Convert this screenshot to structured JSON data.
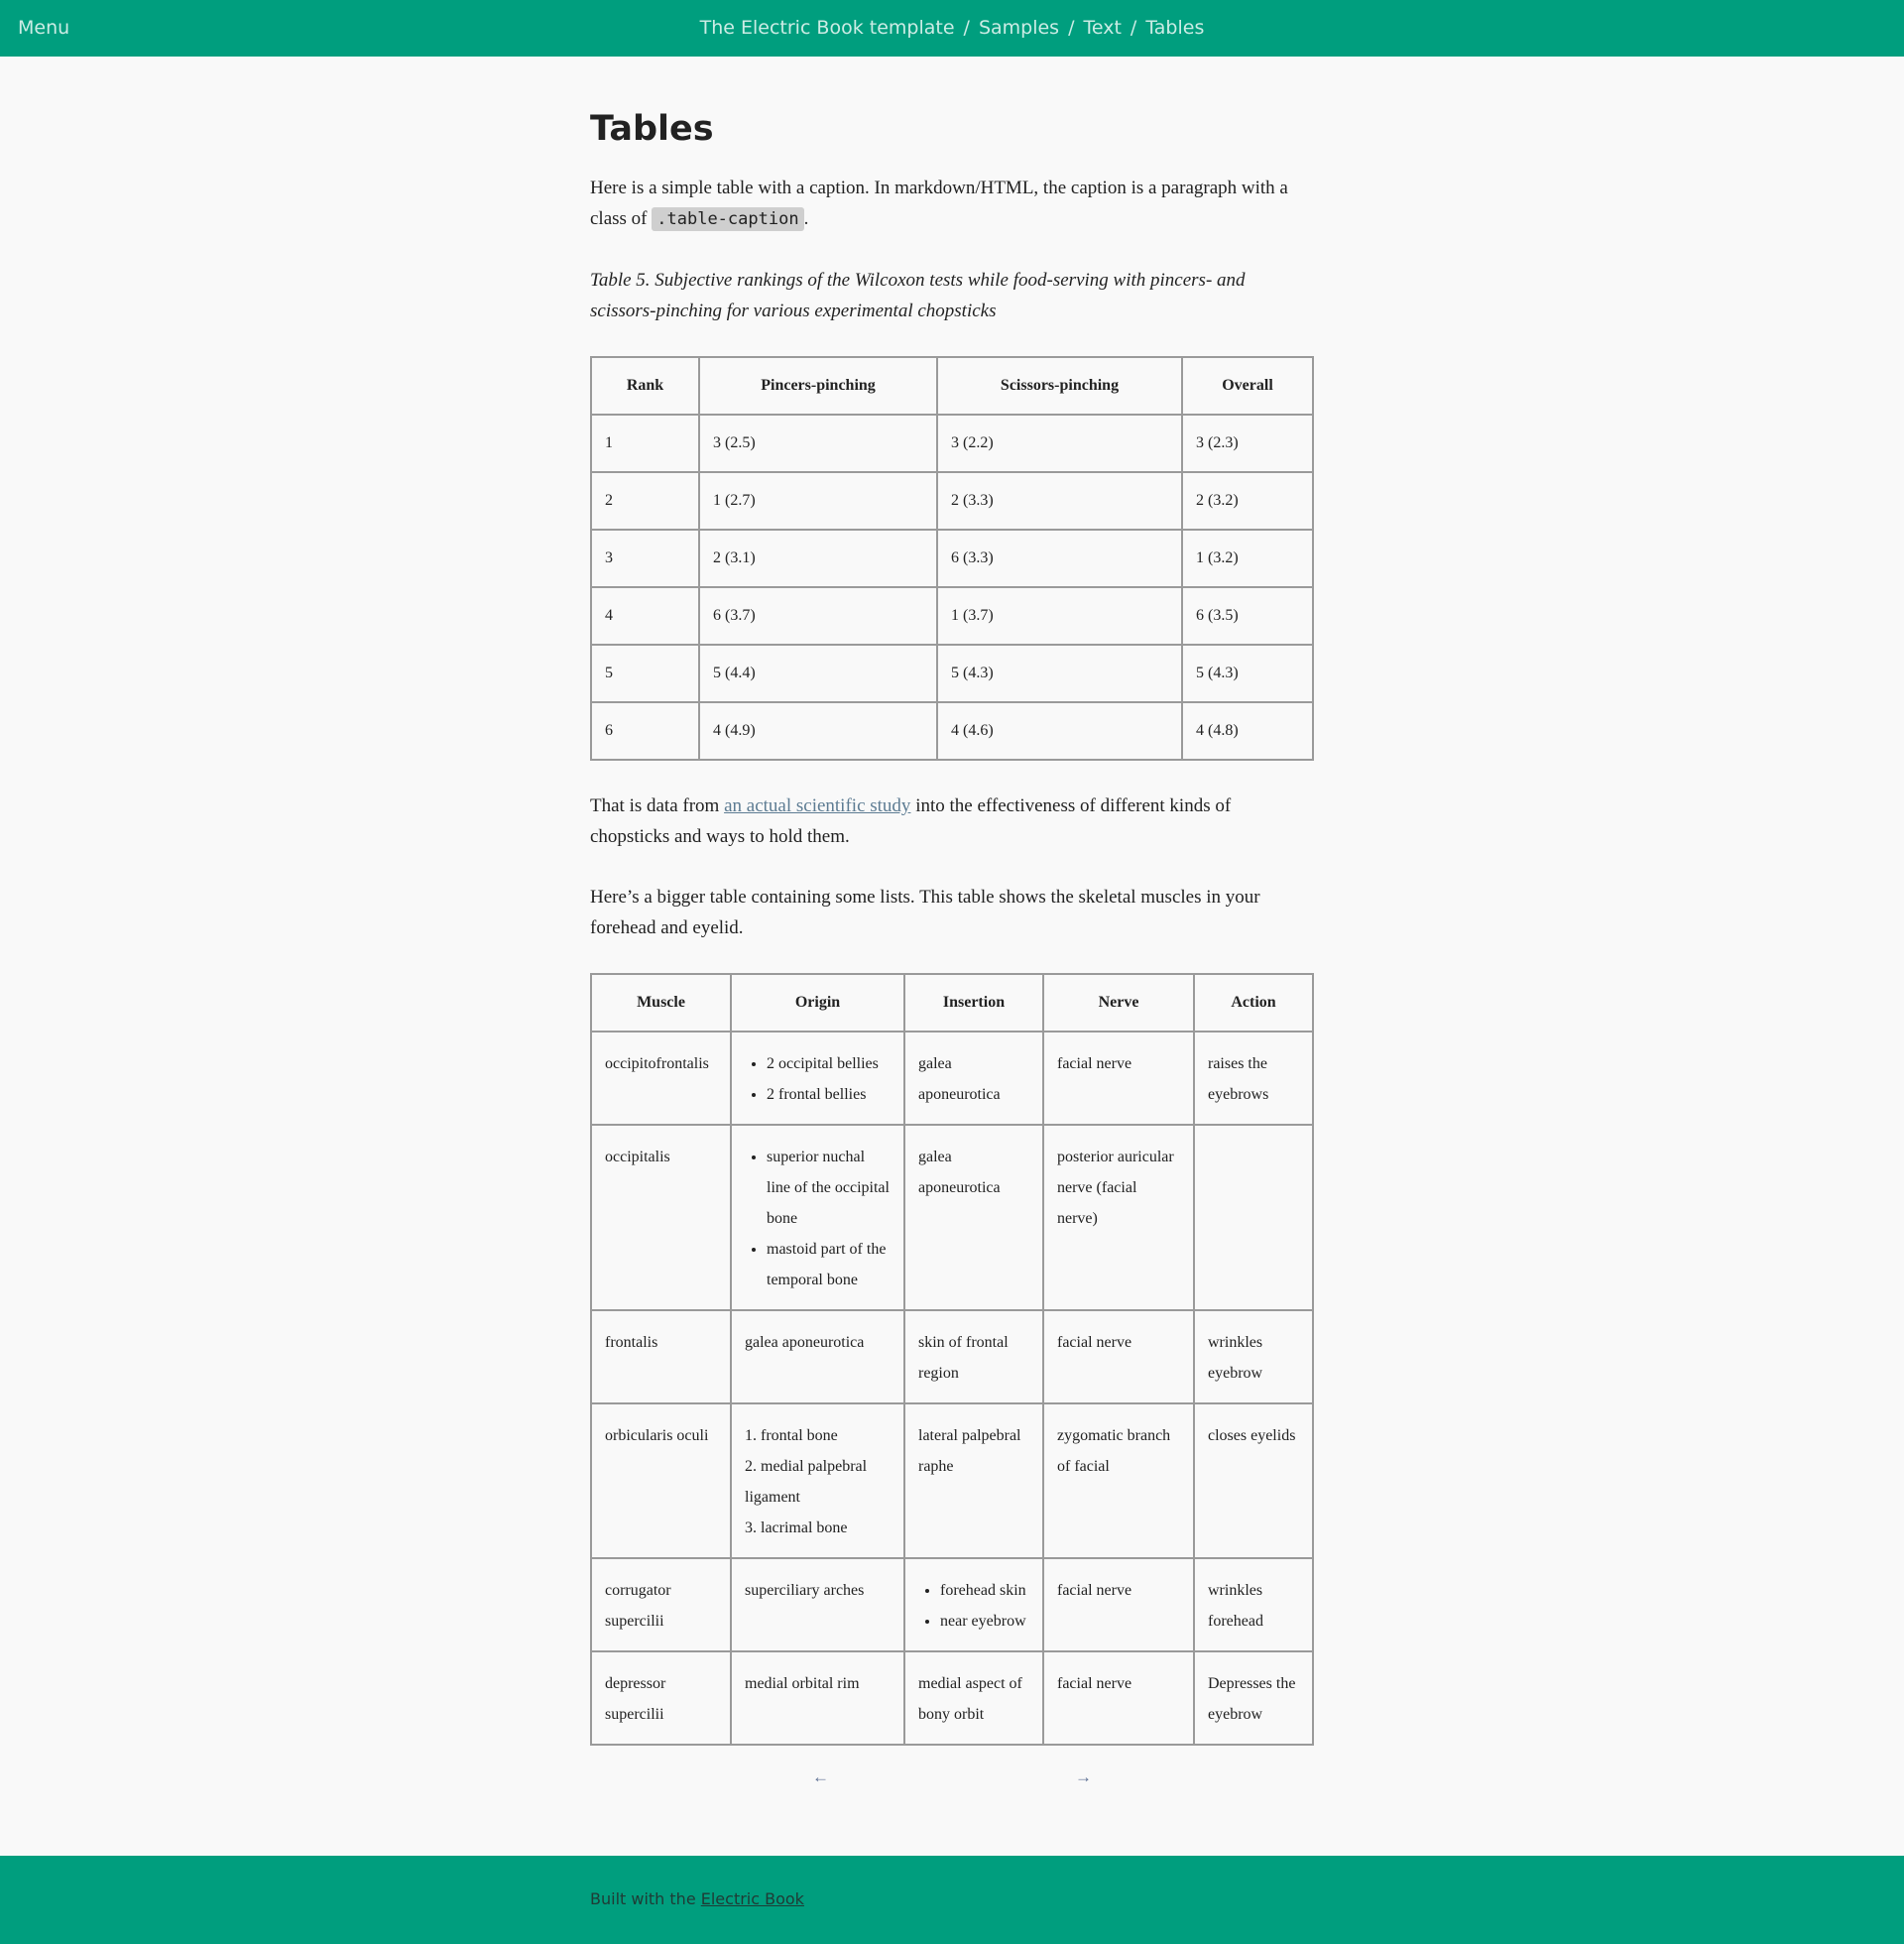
{
  "header": {
    "menu_label": "Menu",
    "breadcrumb": [
      "The Electric Book template",
      "Samples",
      "Text",
      "Tables"
    ],
    "separator": "/"
  },
  "page": {
    "title": "Tables",
    "intro_text": "Here is a simple table with a caption. In markdown/HTML, the caption is a paragraph with a class of",
    "intro_code": ".table-caption",
    "intro_end": ".",
    "caption": "Table 5. Subjective rankings of the Wilcoxon tests while food-serving with pincers- and scissors-pinching for various experimental chopsticks",
    "after_text_1": "That is data from",
    "after_link": "an actual scientific study",
    "after_text_2": "into the effectiveness of different kinds of chopsticks and ways to hold them.",
    "bigger_text": "Here’s a bigger table containing some lists. This table shows the skeletal muscles in your forehead and eyelid."
  },
  "table1": {
    "headers": [
      "Rank",
      "Pincers-pinching",
      "Scissors-pinching",
      "Overall"
    ],
    "rows": [
      [
        "1",
        "3 (2.5)",
        "3 (2.2)",
        "3 (2.3)"
      ],
      [
        "2",
        "1 (2.7)",
        "2 (3.3)",
        "2 (3.2)"
      ],
      [
        "3",
        "2 (3.1)",
        "6 (3.3)",
        "1 (3.2)"
      ],
      [
        "4",
        "6 (3.7)",
        "1 (3.7)",
        "6 (3.5)"
      ],
      [
        "5",
        "5 (4.4)",
        "5 (4.3)",
        "5 (4.3)"
      ],
      [
        "6",
        "4 (4.9)",
        "4 (4.6)",
        "4 (4.8)"
      ]
    ]
  },
  "table2": {
    "headers": [
      "Muscle",
      "Origin",
      "Insertion",
      "Nerve",
      "Action"
    ],
    "rows": [
      {
        "muscle": "occipitofrontalis",
        "origin": [
          "2 occipital bellies",
          "2 frontal bellies"
        ],
        "insertion": "galea aponeurotica",
        "nerve": "facial nerve",
        "action": "raises the eyebrows"
      },
      {
        "muscle": "occipitalis",
        "origin": [
          "superior nuchal line of the occipital bone",
          "mastoid part of the temporal bone"
        ],
        "insertion": "galea aponeurotica",
        "nerve": "posterior auricular nerve (facial nerve)",
        "action": ""
      },
      {
        "muscle": "frontalis",
        "origin": "galea aponeurotica",
        "insertion": "skin of frontal region",
        "nerve": "facial nerve",
        "action": "wrinkles eyebrow"
      },
      {
        "muscle": "orbicularis oculi",
        "origin": [
          "1. frontal bone",
          "2. medial palpebral ligament",
          "3. lacrimal bone"
        ],
        "insertion": "lateral palpebral raphe",
        "nerve": "zygomatic branch of facial",
        "action": "closes eyelids"
      },
      {
        "muscle": "corrugator supercilii",
        "origin": "superciliary arches",
        "insertion": [
          "forehead skin",
          "near eyebrow"
        ],
        "nerve": "facial nerve",
        "action": "wrinkles forehead"
      },
      {
        "muscle": "depressor supercilii",
        "origin": "medial orbital rim",
        "insertion": "medial aspect of bony orbit",
        "nerve": "facial nerve",
        "action": "Depresses the eyebrow"
      }
    ]
  },
  "pager": {
    "prev": "←",
    "next": "→"
  },
  "footer": {
    "text": "Built with the",
    "link": "Electric Book"
  },
  "colors": {
    "brand": "#009e7e",
    "link": "#5d7c93",
    "background": "#f9f9f9"
  }
}
